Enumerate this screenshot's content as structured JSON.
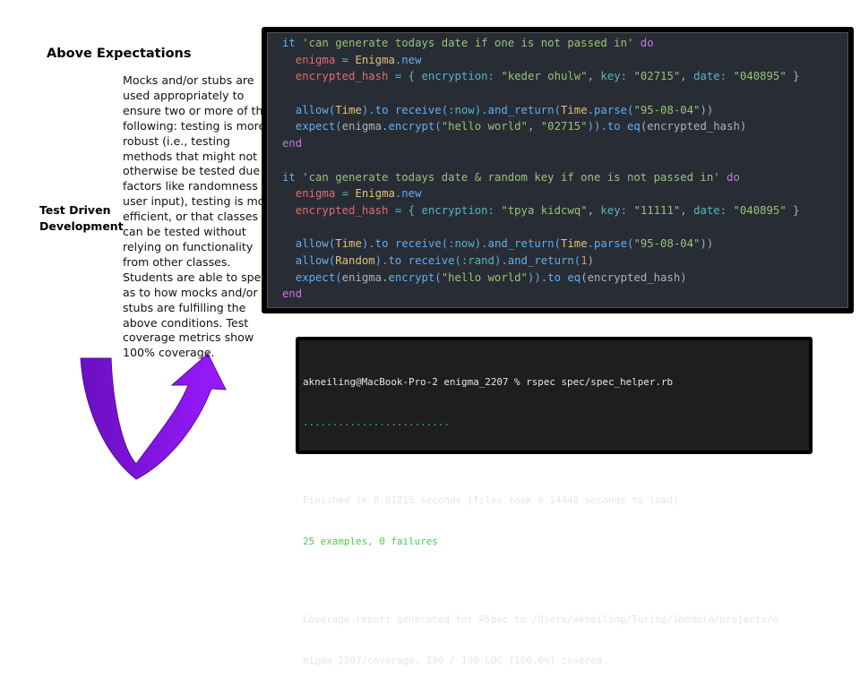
{
  "heading": "Above Expectations",
  "row_label": [
    "Test Driven",
    "Development"
  ],
  "description_lines": [
    "Mocks and/or stubs are",
    "used appropriately to",
    "ensure two or more of the",
    "following: testing is more",
    "robust (i.e., testing",
    "methods that might not",
    "otherwise be tested due to",
    "factors like randomness or",
    "user input), testing is more",
    "efficient, or that classes",
    "can be tested without",
    "relying on functionality",
    "from other classes.",
    "Students are able to speak",
    "as to how mocks and/or",
    "stubs are fulfilling the",
    "above conditions. Test",
    "coverage metrics show",
    "100% coverage."
  ],
  "hidden_heading_fragment": "s",
  "code_lines": [
    [
      [
        "it ",
        "kw"
      ],
      [
        "'can generate todays date if one is not passed in'",
        "str"
      ],
      [
        " do",
        "do"
      ]
    ],
    [
      [
        "  enigma",
        "var"
      ],
      [
        " = ",
        "op"
      ],
      [
        "Enigma",
        "const"
      ],
      [
        ".new",
        "meth"
      ]
    ],
    [
      [
        "  encrypted_hash",
        "var"
      ],
      [
        " = { ",
        "op"
      ],
      [
        "encryption: ",
        "sym"
      ],
      [
        "\"keder ohulw\"",
        "str"
      ],
      [
        ", ",
        "plain"
      ],
      [
        "key: ",
        "sym"
      ],
      [
        "\"02715\"",
        "str"
      ],
      [
        ", ",
        "plain"
      ],
      [
        "date: ",
        "sym"
      ],
      [
        "\"040895\"",
        "str"
      ],
      [
        " }",
        "plain"
      ]
    ],
    [],
    [
      [
        "  allow(",
        "meth"
      ],
      [
        "Time",
        "const"
      ],
      [
        ").to receive(",
        "meth"
      ],
      [
        ":now",
        "sym"
      ],
      [
        ").and_return(",
        "meth"
      ],
      [
        "Time",
        "const"
      ],
      [
        ".parse(",
        "meth"
      ],
      [
        "\"95-08-04\"",
        "str"
      ],
      [
        "))",
        "plain"
      ]
    ],
    [
      [
        "  expect(",
        "meth"
      ],
      [
        "enigma.",
        "plain"
      ],
      [
        "encrypt(",
        "meth"
      ],
      [
        "\"hello world\"",
        "str"
      ],
      [
        ", ",
        "plain"
      ],
      [
        "\"02715\"",
        "str"
      ],
      [
        ")).to ",
        "meth"
      ],
      [
        "eq",
        "meth"
      ],
      [
        "(encrypted_hash)",
        "plain"
      ]
    ],
    [
      [
        "end",
        "do"
      ]
    ],
    [],
    [
      [
        "it ",
        "kw"
      ],
      [
        "'can generate todays date & random key if one is not passed in'",
        "str"
      ],
      [
        " do",
        "do"
      ]
    ],
    [
      [
        "  enigma",
        "var"
      ],
      [
        " = ",
        "op"
      ],
      [
        "Enigma",
        "const"
      ],
      [
        ".new",
        "meth"
      ]
    ],
    [
      [
        "  encrypted_hash",
        "var"
      ],
      [
        " = { ",
        "op"
      ],
      [
        "encryption: ",
        "sym"
      ],
      [
        "\"tpya kidcwq\"",
        "str"
      ],
      [
        ", ",
        "plain"
      ],
      [
        "key: ",
        "sym"
      ],
      [
        "\"11111\"",
        "str"
      ],
      [
        ", ",
        "plain"
      ],
      [
        "date: ",
        "sym"
      ],
      [
        "\"040895\"",
        "str"
      ],
      [
        " }",
        "plain"
      ]
    ],
    [],
    [
      [
        "  allow(",
        "meth"
      ],
      [
        "Time",
        "const"
      ],
      [
        ").to receive(",
        "meth"
      ],
      [
        ":now",
        "sym"
      ],
      [
        ").and_return(",
        "meth"
      ],
      [
        "Time",
        "const"
      ],
      [
        ".parse(",
        "meth"
      ],
      [
        "\"95-08-04\"",
        "str"
      ],
      [
        "))",
        "plain"
      ]
    ],
    [
      [
        "  allow(",
        "meth"
      ],
      [
        "Random",
        "const"
      ],
      [
        ").to receive(",
        "meth"
      ],
      [
        ":rand",
        "sym"
      ],
      [
        ").and_return(",
        "meth"
      ],
      [
        "1",
        "num"
      ],
      [
        ")",
        "plain"
      ]
    ],
    [
      [
        "  expect(",
        "meth"
      ],
      [
        "enigma.",
        "plain"
      ],
      [
        "encrypt(",
        "meth"
      ],
      [
        "\"hello world\"",
        "str"
      ],
      [
        ")).to ",
        "meth"
      ],
      [
        "eq",
        "meth"
      ],
      [
        "(encrypted_hash)",
        "plain"
      ]
    ],
    [
      [
        "end",
        "do"
      ]
    ]
  ],
  "terminal": {
    "prompt": "akneiling@MacBook-Pro-2 enigma_2207 % rspec spec/spec_helper.rb",
    "progress": ".........................",
    "finished": "Finished in 0.01215 seconds (files took 0.14448 seconds to load)",
    "summary": "25 examples, 0 failures",
    "coverage_1": "Coverage report generated for RSpec to /Users/akneiling/Turing/1module/projects/e",
    "coverage_2": "nigma_2207/coverage. 190 / 190 LOC (100.0%) covered."
  },
  "colors": {
    "arrow": "#8a12f0",
    "arrow_dark": "#6a0fc0",
    "code_bg": "#282c34",
    "terminal_green": "#4fc94f"
  },
  "icons": {
    "arrow": "u-turn-arrow-icon"
  }
}
